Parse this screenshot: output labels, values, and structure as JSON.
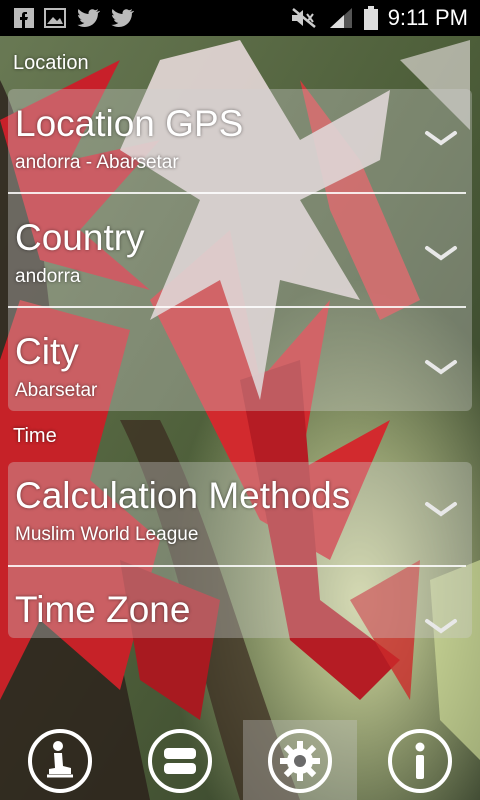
{
  "status_bar": {
    "time": "9:11 PM",
    "left_icons": [
      "facebook-icon",
      "gallery-icon",
      "twitter-icon",
      "twitter-icon"
    ],
    "right_icons": [
      "mute-icon",
      "signal-icon",
      "battery-icon"
    ]
  },
  "sections": {
    "location": {
      "header": "Location",
      "items": [
        {
          "title": "Location GPS",
          "value": "andorra - Abarsetar"
        },
        {
          "title": "Country",
          "value": "andorra"
        },
        {
          "title": "City",
          "value": "Abarsetar"
        }
      ]
    },
    "time": {
      "header": "Time",
      "items": [
        {
          "title": "Calculation Methods",
          "value": "Muslim World League"
        },
        {
          "title": "Time Zone",
          "value": ""
        }
      ]
    }
  },
  "bottom_nav": [
    {
      "icon": "prayer-icon",
      "active": false
    },
    {
      "icon": "stack-icon",
      "active": false
    },
    {
      "icon": "settings-gear-icon",
      "active": true
    },
    {
      "icon": "info-icon",
      "active": false
    }
  ],
  "colors": {
    "accent_red": "#d8242a",
    "card_overlay": "rgba(210,210,210,0.35)",
    "statusbar": "#000000"
  }
}
